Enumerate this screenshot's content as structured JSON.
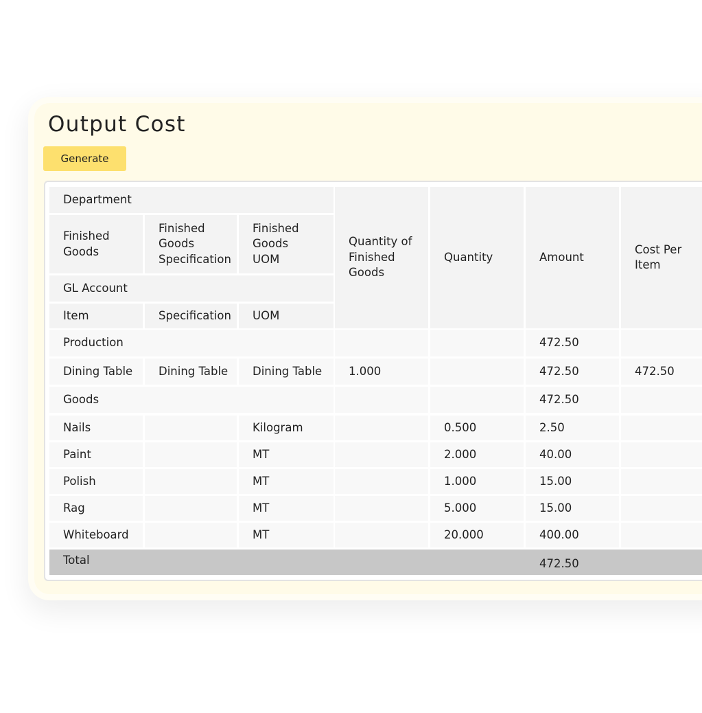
{
  "page": {
    "title": "Output Cost",
    "generate_label": "Generate"
  },
  "table": {
    "headers": {
      "department": "Department",
      "finished_goods": "Finished Goods",
      "finished_goods_spec": "Finished Goods Specification",
      "finished_goods_uom": "Finished Goods UOM",
      "gl_account": "GL Account",
      "item": "Item",
      "specification": "Specification",
      "uom": "UOM",
      "qty_finished_goods": "Quantity of Finished Goods",
      "quantity": "Quantity",
      "amount": "Amount",
      "cost_per_item": "Cost Per Item"
    },
    "production": {
      "label": "Production",
      "amount": "472.50"
    },
    "finished_good": {
      "name": "Dining Table",
      "specification": "Dining Table",
      "uom": "Dining Table",
      "quantity": "1.000",
      "amount": "472.50",
      "cost_per_item": "472.50"
    },
    "goods": {
      "label": "Goods",
      "amount": "472.50"
    },
    "items": [
      {
        "item": "Nails",
        "uom": "Kilogram",
        "quantity": "0.500",
        "amount": "2.50"
      },
      {
        "item": "Paint",
        "uom": "MT",
        "quantity": "2.000",
        "amount": "40.00"
      },
      {
        "item": "Polish",
        "uom": "MT",
        "quantity": "1.000",
        "amount": "15.00"
      },
      {
        "item": "Rag",
        "uom": "MT",
        "quantity": "5.000",
        "amount": "15.00"
      },
      {
        "item": "Whiteboard",
        "uom": "MT",
        "quantity": "20.000",
        "amount": "400.00"
      }
    ],
    "total": {
      "label": "Total",
      "amount": "472.50"
    }
  }
}
